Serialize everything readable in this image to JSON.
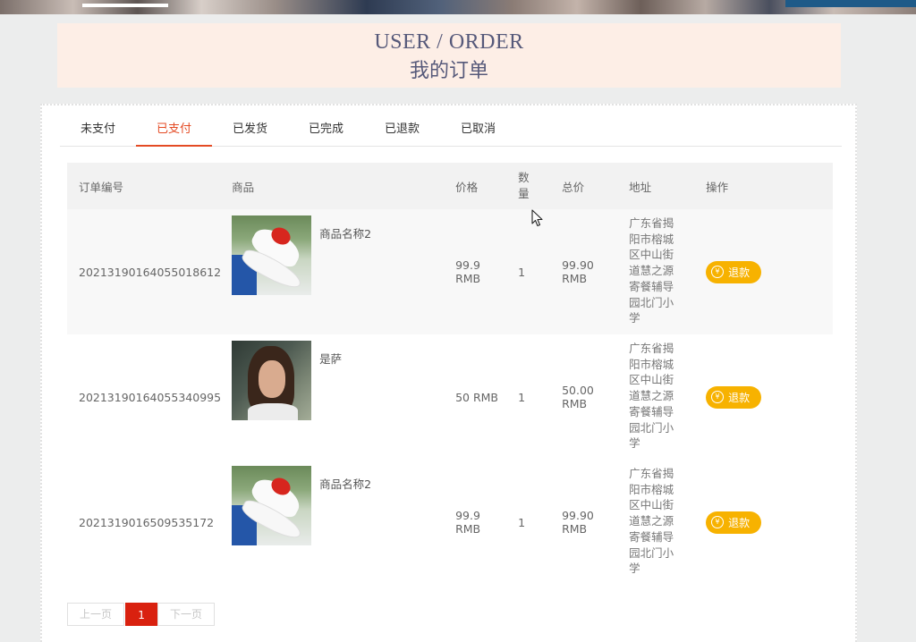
{
  "header": {
    "title_en": "USER / ORDER",
    "title_cn": "我的订单"
  },
  "tabs": [
    {
      "label": "未支付",
      "active": false
    },
    {
      "label": "已支付",
      "active": true
    },
    {
      "label": "已发货",
      "active": false
    },
    {
      "label": "已完成",
      "active": false
    },
    {
      "label": "已退款",
      "active": false
    },
    {
      "label": "已取消",
      "active": false
    }
  ],
  "table": {
    "headers": {
      "order_id": "订单编号",
      "product": "商品",
      "price": "价格",
      "qty": "数量",
      "total": "总价",
      "address": "地址",
      "action": "操作"
    },
    "rows": [
      {
        "order_id": "20213190164055018612",
        "image": "shoe",
        "product_name": "商品名称2",
        "price": "99.9 RMB",
        "qty": "1",
        "total": "99.90 RMB",
        "address": "广东省揭阳市榕城区中山街道慧之源寄餐辅导园北门小学",
        "action": "退款"
      },
      {
        "order_id": "20213190164055340995",
        "image": "portrait",
        "product_name": "是萨",
        "price": "50 RMB",
        "qty": "1",
        "total": "50.00 RMB",
        "address": "广东省揭阳市榕城区中山街道慧之源寄餐辅导园北门小学",
        "action": "退款"
      },
      {
        "order_id": "2021319016509535172",
        "image": "shoe",
        "product_name": "商品名称2",
        "price": "99.9 RMB",
        "qty": "1",
        "total": "99.90 RMB",
        "address": "广东省揭阳市榕城区中山街道慧之源寄餐辅导园北门小学",
        "action": "退款"
      }
    ]
  },
  "pagination": {
    "prev": "上一页",
    "current": "1",
    "next": "下一页"
  },
  "icons": {
    "refund": "yen-icon",
    "cursor": "mouse-pointer-icon"
  },
  "colors": {
    "accent": "#e44b24",
    "refund_button": "#f7b200",
    "page_active": "#d9210f",
    "header_bg": "#fdeee6"
  }
}
